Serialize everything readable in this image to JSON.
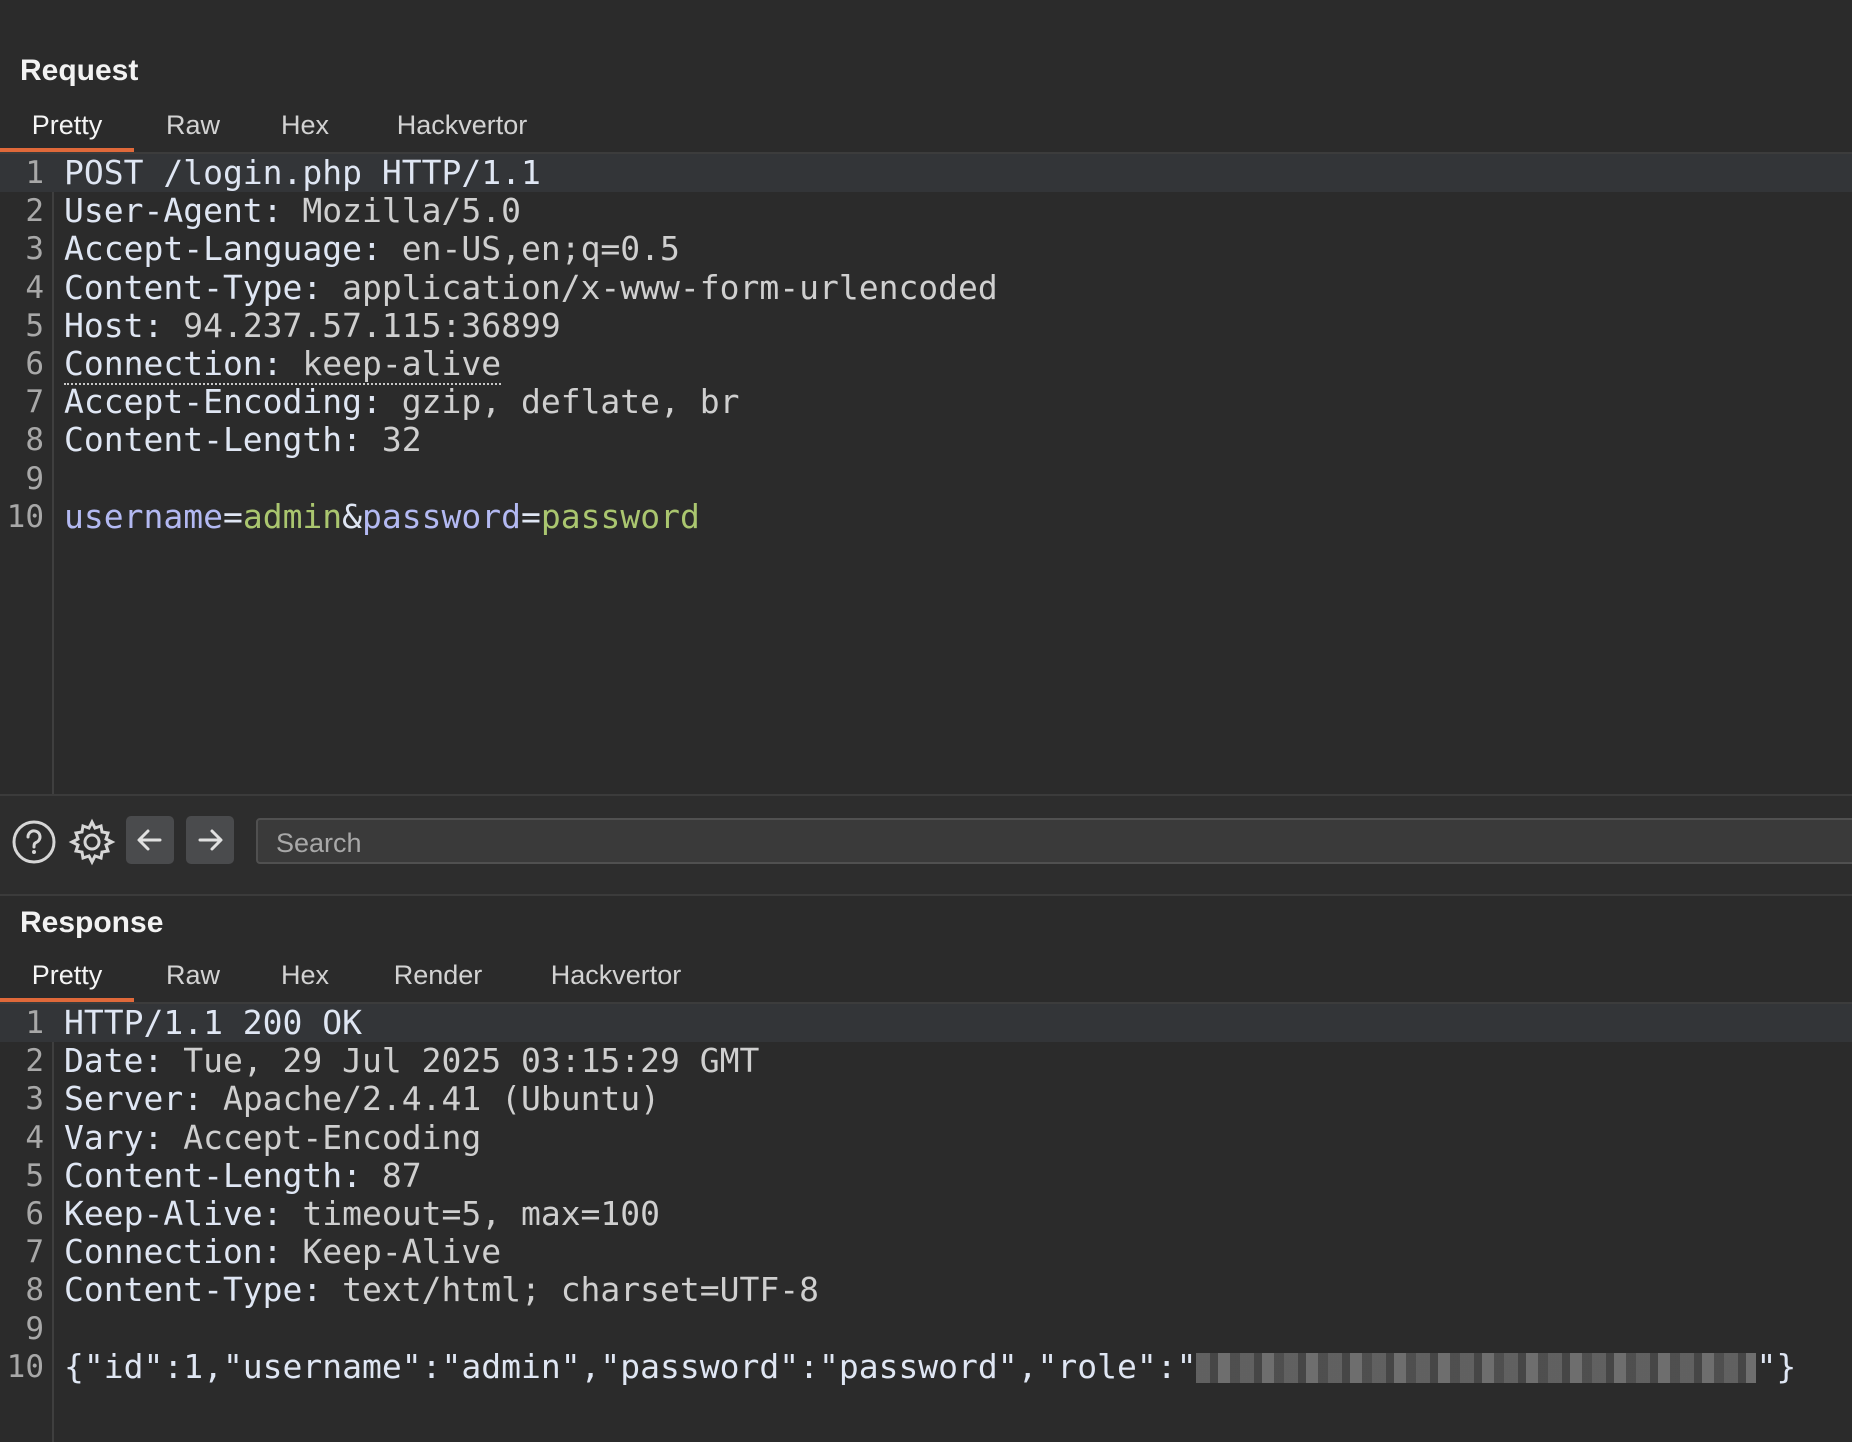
{
  "request": {
    "title": "Request",
    "tabs": [
      "Pretty",
      "Raw",
      "Hex",
      "Hackvertor"
    ],
    "active_tab": "Pretty",
    "lines": [
      {
        "n": "1",
        "text": "POST /login.php HTTP/1.1"
      },
      {
        "n": "2",
        "key": "User-Agent:",
        "value": " Mozilla/5.0"
      },
      {
        "n": "3",
        "key": "Accept-Language:",
        "value": " en-US,en;q=0.5"
      },
      {
        "n": "4",
        "key": "Content-Type:",
        "value": " application/x-www-form-urlencoded"
      },
      {
        "n": "5",
        "key": "Host:",
        "value": " 94.237.57.115:36899"
      },
      {
        "n": "6",
        "key": "Connection:",
        "value": " keep-alive"
      },
      {
        "n": "7",
        "key": "Accept-Encoding:",
        "value": " gzip, deflate, br"
      },
      {
        "n": "8",
        "key": "Content-Length:",
        "value": " 32"
      },
      {
        "n": "9",
        "text": ""
      },
      {
        "n": "10",
        "params": [
          {
            "k": "username",
            "eq": "=",
            "v": "admin"
          },
          {
            "sep": "&"
          },
          {
            "k": "password",
            "eq": "=",
            "v": "password"
          }
        ]
      }
    ]
  },
  "toolbar": {
    "search_placeholder": "Search",
    "icons": [
      "help-icon",
      "settings-gear-icon",
      "arrow-left-icon",
      "arrow-right-icon"
    ]
  },
  "response": {
    "title": "Response",
    "tabs": [
      "Pretty",
      "Raw",
      "Hex",
      "Render",
      "Hackvertor"
    ],
    "active_tab": "Pretty",
    "lines": [
      {
        "n": "1",
        "text": "HTTP/1.1 200 OK"
      },
      {
        "n": "2",
        "key": "Date:",
        "value": " Tue, 29 Jul 2025 03:15:29 GMT"
      },
      {
        "n": "3",
        "key": "Server:",
        "value": " Apache/2.4.41 (Ubuntu)"
      },
      {
        "n": "4",
        "key": "Vary:",
        "value": " Accept-Encoding"
      },
      {
        "n": "5",
        "key": "Content-Length:",
        "value": " 87"
      },
      {
        "n": "6",
        "key": "Keep-Alive:",
        "value": " timeout=5, max=100"
      },
      {
        "n": "7",
        "key": "Connection:",
        "value": " Keep-Alive"
      },
      {
        "n": "8",
        "key": "Content-Type:",
        "value": " text/html; charset=UTF-8"
      },
      {
        "n": "9",
        "text": ""
      },
      {
        "n": "10",
        "body_prefix": "{\"id\":1,\"username\":\"admin\",\"password\":\"password\",\"role\":\"",
        "body_suffix": "\"}"
      }
    ]
  },
  "colors": {
    "background": "#2b2b2b",
    "active_tab_underline": "#e0693a",
    "param_name": "#b3b9f2",
    "param_value": "#aac66f"
  }
}
